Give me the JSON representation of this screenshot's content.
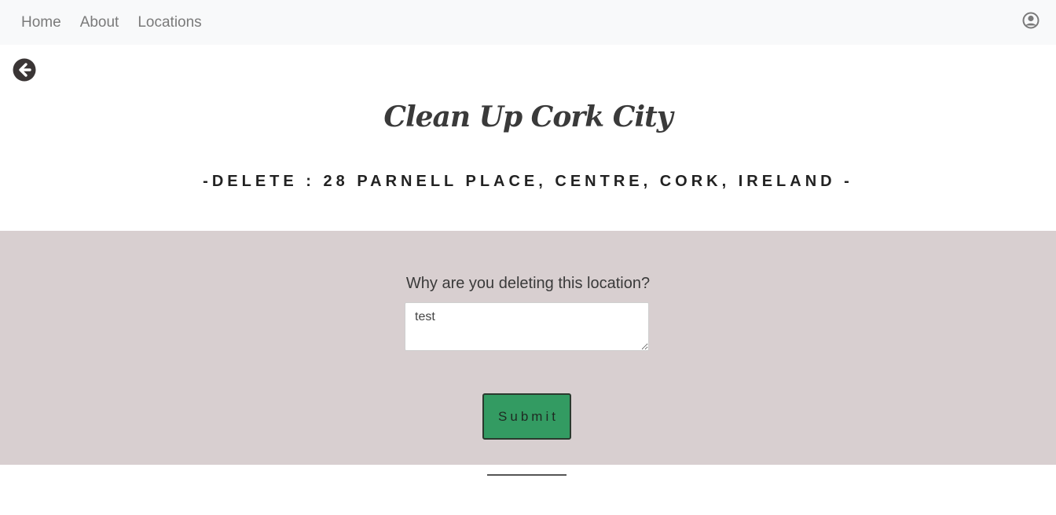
{
  "nav": {
    "items": [
      {
        "label": "Home"
      },
      {
        "label": "About"
      },
      {
        "label": "Locations"
      }
    ],
    "user_icon": "user-circle-icon"
  },
  "back_icon": "arrow-left-circle-icon",
  "site_title": "Clean Up Cork City",
  "heading": {
    "prefix": "-DELETE : ",
    "address": "28 PARNELL PLACE, CENTRE, CORK, IRELAND",
    "suffix": " -"
  },
  "form": {
    "question": "Why are you deleting this location?",
    "reason_value": "test",
    "submit_label": "Submit"
  },
  "colors": {
    "navbar_bg": "#f8f9fa",
    "form_band_bg": "#d8cfd0",
    "submit_bg": "#339b62",
    "text": "#3a3a3a"
  }
}
